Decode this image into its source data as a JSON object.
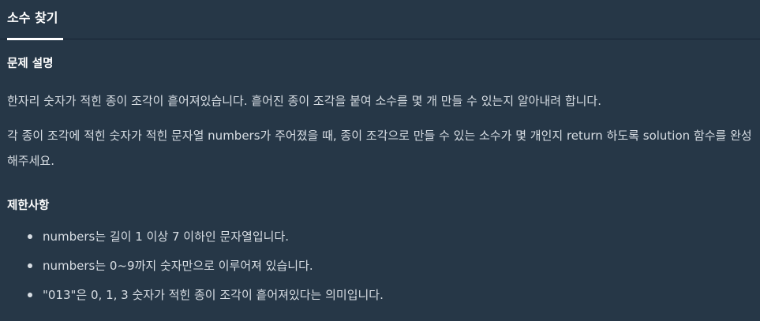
{
  "tab": {
    "label": "소수 찾기"
  },
  "description": {
    "heading": "문제 설명",
    "paragraphs": [
      "한자리 숫자가 적힌 종이 조각이 흩어져있습니다. 흩어진 종이 조각을 붙여 소수를 몇 개 만들 수 있는지 알아내려 합니다.",
      "각 종이 조각에 적힌 숫자가 적힌 문자열 numbers가 주어졌을 때, 종이 조각으로 만들 수 있는 소수가 몇 개인지 return 하도록 solution 함수를 완성해주세요."
    ]
  },
  "constraints": {
    "heading": "제한사항",
    "items": [
      "numbers는 길이 1 이상 7 이하인 문자열입니다.",
      "numbers는 0~9까지 숫자만으로 이루어져 있습니다.",
      "\"013\"은 0, 1, 3 숫자가 적힌 종이 조각이 흩어져있다는 의미입니다."
    ]
  },
  "colors": {
    "background": "#263747",
    "heading": "#ffffff",
    "text": "#d8dee4",
    "divider": "#172334"
  }
}
